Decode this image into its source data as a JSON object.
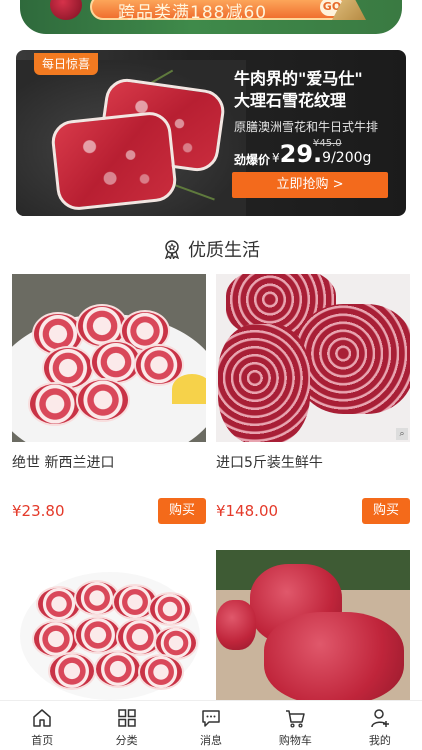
{
  "top_banner": {
    "text": "跨品类满188减60",
    "go_label": "GO"
  },
  "promo": {
    "tag": "每日惊喜",
    "headline_line1": "牛肉界的\"爱马仕\"",
    "headline_line2": "大理石雪花纹理",
    "subtitle": "原膳澳洲雪花和牛日式牛排",
    "price_label": "劲爆价",
    "price_symbol": "¥",
    "price_main": "29.",
    "price_decimal": "9",
    "price_unit": "/200g",
    "old_price": "¥45.0",
    "cta": "立即抢购 >"
  },
  "section": {
    "title": "优质生活",
    "icon": "ribbon-badge-icon"
  },
  "products": [
    {
      "name": "绝世 新西兰进口",
      "price": "¥23.80",
      "buy_label": "购买"
    },
    {
      "name": "进口5斤装生鲜牛",
      "price": "¥148.00",
      "buy_label": "购买"
    },
    {
      "name": "",
      "price": "",
      "buy_label": ""
    },
    {
      "name": "",
      "price": "",
      "buy_label": ""
    }
  ],
  "tabbar": [
    {
      "label": "首页",
      "icon": "home-icon"
    },
    {
      "label": "分类",
      "icon": "grid-icon"
    },
    {
      "label": "消息",
      "icon": "message-icon"
    },
    {
      "label": "购物车",
      "icon": "cart-icon"
    },
    {
      "label": "我的",
      "icon": "user-add-icon"
    }
  ],
  "colors": {
    "accent": "#f46a1a",
    "price": "#e43a2a"
  }
}
